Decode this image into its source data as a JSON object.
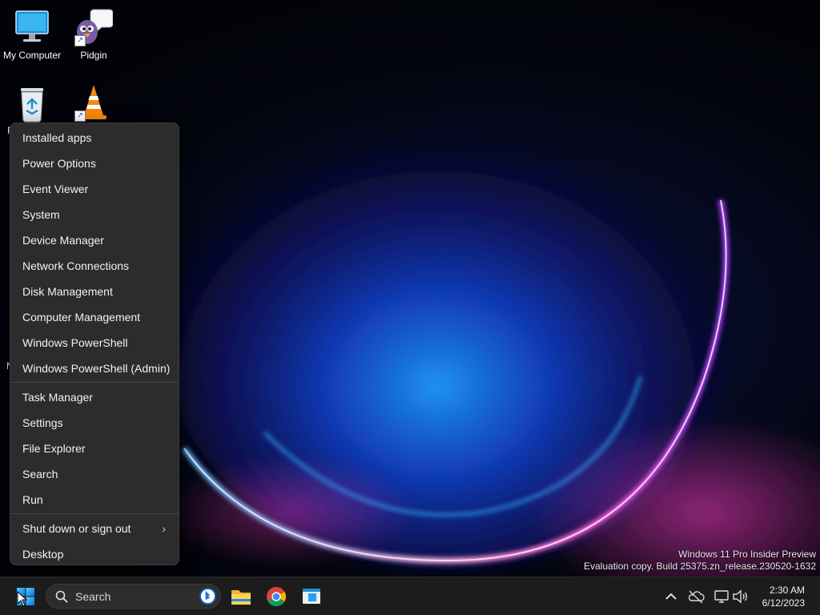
{
  "desktop": {
    "icons": [
      {
        "label": "My Computer",
        "icon": "monitor-icon"
      },
      {
        "label": "Pidgin",
        "icon": "pidgin-icon"
      },
      {
        "label": "R",
        "icon": "recycle-bin-icon"
      },
      {
        "label": "",
        "icon": "vlc-icon"
      },
      {
        "label": "N",
        "icon": "hidden-icon"
      }
    ]
  },
  "context_menu": {
    "group1": [
      "Installed apps",
      "Power Options",
      "Event Viewer",
      "System",
      "Device Manager",
      "Network Connections",
      "Disk Management",
      "Computer Management",
      "Windows PowerShell",
      "Windows PowerShell (Admin)"
    ],
    "group2": [
      "Task Manager",
      "Settings",
      "File Explorer",
      "Search",
      "Run"
    ],
    "group3": [
      "Shut down or sign out",
      "Desktop"
    ]
  },
  "watermark": {
    "line1": "Windows 11 Pro Insider Preview",
    "line2": "Evaluation copy. Build 25375.zn_release.230520-1632"
  },
  "taskbar": {
    "search_label": "Search",
    "pinned": [
      "start-icon",
      "file-explorer-icon",
      "chrome-icon",
      "app-window-icon"
    ],
    "tray": [
      "chevron-up-icon",
      "onedrive-offline-icon",
      "network-icon",
      "volume-icon"
    ],
    "time": "2:30 AM",
    "date": "6/12/2023"
  },
  "colors": {
    "taskbar": "#1c1c1c",
    "menu_bg": "#2c2c2c",
    "wallpaper_glow_blue": "#1a8cff",
    "wallpaper_glow_pink": "#ff4fd8"
  }
}
